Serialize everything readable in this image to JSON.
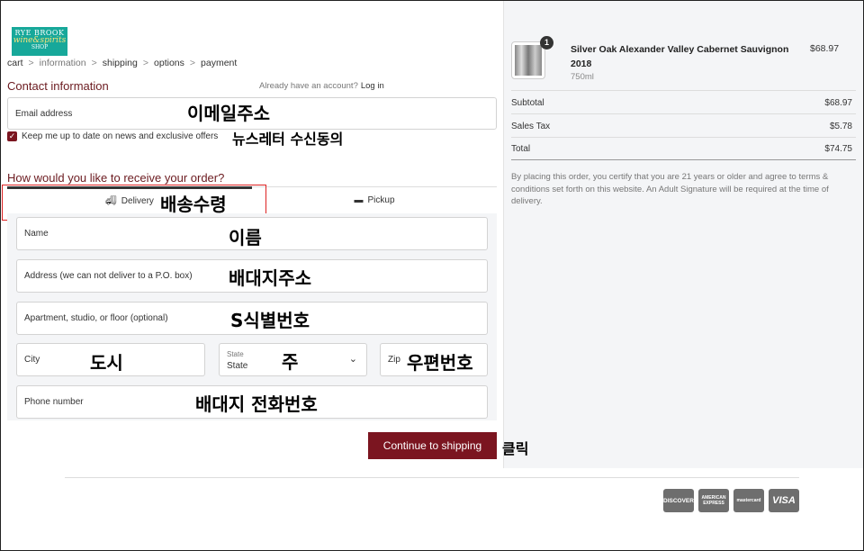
{
  "logo": {
    "line1": "RYE BROOK",
    "line2": "wine&spirits",
    "line3": "SHOP"
  },
  "breadcrumb": {
    "cart": "cart",
    "information": "information",
    "shipping": "shipping",
    "options": "options",
    "payment": "payment",
    "sep": ">"
  },
  "contact": {
    "title": "Contact information",
    "have_account": "Already have an account?",
    "login": "Log in",
    "email_placeholder": "Email address",
    "newsletter_label": "Keep me up to date on news and exclusive offers"
  },
  "delivery": {
    "title": "How would you like to receive your order?",
    "tab_delivery": "Delivery",
    "tab_pickup": "Pickup"
  },
  "form": {
    "name": "Name",
    "address": "Address (we can not deliver to a P.O. box)",
    "apartment": "Apartment, studio, or floor (optional)",
    "city": "City",
    "state_label": "State",
    "state_value": "State",
    "zip": "Zip",
    "phone": "Phone number"
  },
  "continue_button": "Continue to shipping",
  "annotations": {
    "email": "이메일주소",
    "newsletter": "뉴스레터 수신동의",
    "delivery": "배송수령",
    "name": "이름",
    "address": "배대지주소",
    "apartment": "S식별번호",
    "city": "도시",
    "state": "주",
    "zip": "우편번호",
    "phone": "배대지 전화번호",
    "click": "클릭"
  },
  "payment_icons": [
    "DISCOVER",
    "AMERICAN EXPRESS",
    "mastercard",
    "VISA"
  ],
  "order": {
    "quantity": "1",
    "product_name": "Silver Oak Alexander Valley Cabernet Sauvignon 2018",
    "product_size": "750ml",
    "product_price": "$68.97",
    "subtotal_label": "Subtotal",
    "subtotal": "$68.97",
    "tax_label": "Sales Tax",
    "tax": "$5.78",
    "total_label": "Total",
    "total": "$74.75",
    "notice": "By placing this order, you certify that you are 21 years or older and agree to terms & conditions set forth on this website. An Adult Signature will be required at the time of delivery."
  },
  "colors": {
    "brand": "#7b1520",
    "annotation_box": "#dd2222",
    "logo_bg": "#17a89a"
  }
}
